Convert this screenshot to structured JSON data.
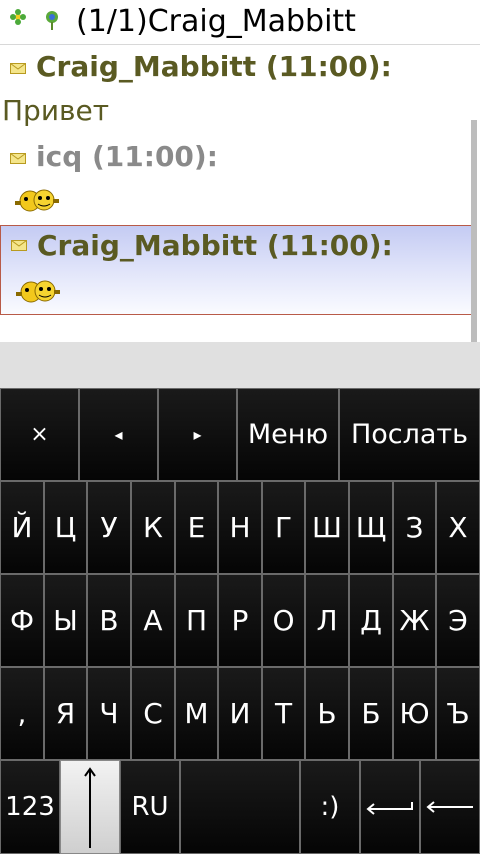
{
  "header": {
    "title": "(1/1)Craig_Mabbitt",
    "status_icon": "flower-status-icon",
    "client_icon": "client-icon"
  },
  "messages": [
    {
      "sender": "Craig_Mabbitt (11:00):",
      "text": "Привет",
      "sender_color": "#5a5a22"
    },
    {
      "sender": "icq (11:00):",
      "text": "",
      "sender_color": "#8a8a8a",
      "smiley": true
    },
    {
      "sender": "Craig_Mabbitt (11:00):",
      "text": "",
      "sender_color": "#5a5a22",
      "smiley": true
    }
  ],
  "softkeys": {
    "close": "×",
    "left": "◂",
    "right": "▸",
    "menu": "Меню",
    "send": "Послать"
  },
  "keys": {
    "row1": [
      "Й",
      "Ц",
      "У",
      "К",
      "Е",
      "Н",
      "Г",
      "Ш",
      "Щ",
      "З",
      "Х"
    ],
    "row2": [
      "Ф",
      "Ы",
      "В",
      "А",
      "П",
      "Р",
      "О",
      "Л",
      "Д",
      "Ж",
      "Э"
    ],
    "row3": [
      ",",
      "Я",
      "Ч",
      "С",
      "М",
      "И",
      "Т",
      "Ь",
      "Б",
      "Ю",
      "Ъ"
    ]
  },
  "bottom": {
    "num": "123",
    "lang": "RU",
    "smile": ":)"
  }
}
